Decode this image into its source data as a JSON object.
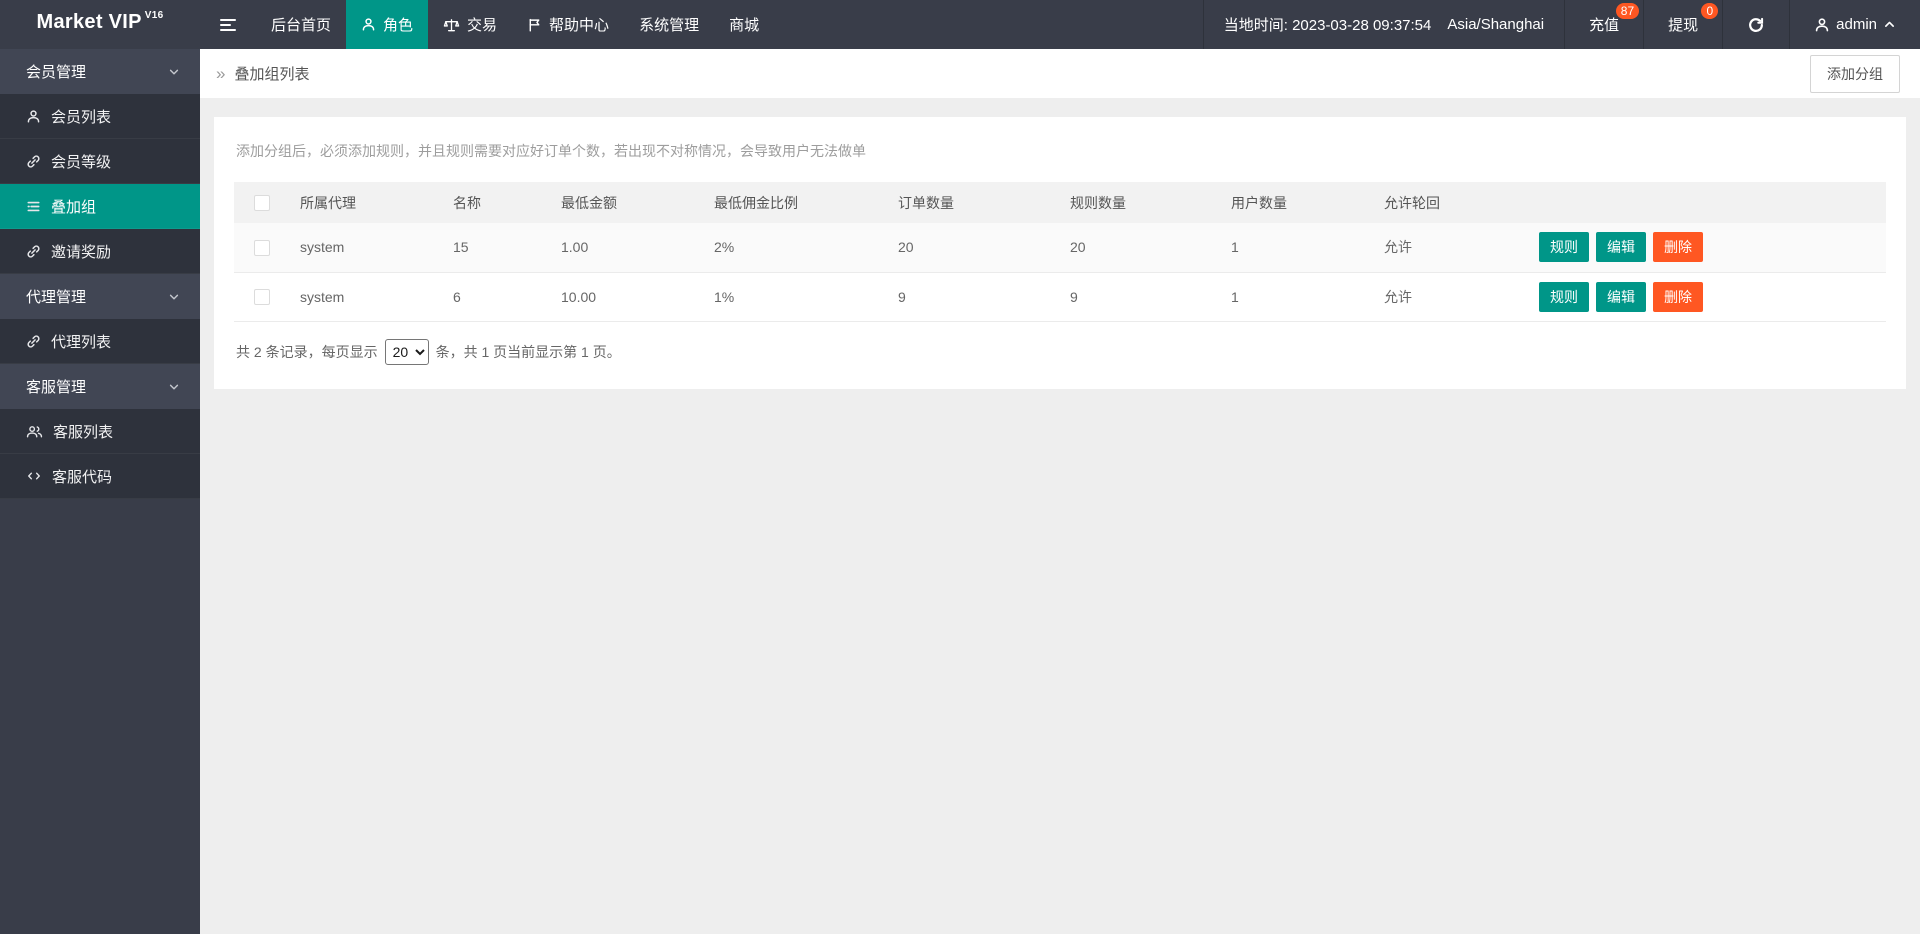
{
  "navbar": {
    "logo": "Market VIP",
    "logo_sup": "V16",
    "menu": [
      {
        "label": "后台首页",
        "icon": null,
        "active": false
      },
      {
        "label": "角色",
        "icon": "person",
        "active": true
      },
      {
        "label": "交易",
        "icon": "scales",
        "active": false
      },
      {
        "label": "帮助中心",
        "icon": "flag",
        "active": false
      },
      {
        "label": "系统管理",
        "icon": null,
        "active": false
      },
      {
        "label": "商城",
        "icon": null,
        "active": false
      }
    ],
    "time_label": "当地时间: 2023-03-28 09:37:54",
    "timezone": "Asia/Shanghai",
    "recharge": {
      "label": "充值",
      "badge": "87"
    },
    "withdraw": {
      "label": "提现",
      "badge": "0"
    },
    "user": "admin"
  },
  "sidebar": {
    "items": [
      {
        "type": "group",
        "label": "会员管理"
      },
      {
        "type": "item",
        "label": "会员列表",
        "icon": "person",
        "active": false
      },
      {
        "type": "item",
        "label": "会员等级",
        "icon": "link",
        "active": false
      },
      {
        "type": "item",
        "label": "叠加组",
        "icon": "list",
        "active": true
      },
      {
        "type": "item",
        "label": "邀请奖励",
        "icon": "link",
        "active": false
      },
      {
        "type": "group",
        "label": "代理管理"
      },
      {
        "type": "item",
        "label": "代理列表",
        "icon": "link",
        "active": false
      },
      {
        "type": "group",
        "label": "客服管理"
      },
      {
        "type": "item",
        "label": "客服列表",
        "icon": "users",
        "active": false
      },
      {
        "type": "item",
        "label": "客服代码",
        "icon": "code",
        "active": false
      }
    ]
  },
  "breadcrumb": {
    "icon": "»",
    "title": "叠加组列表"
  },
  "toolbar": {
    "add_group_label": "添加分组"
  },
  "main": {
    "hint": "添加分组后，必须添加规则，并且规则需要对应好订单个数，若出现不对称情况，会导致用户无法做单",
    "table": {
      "columns": [
        "所属代理",
        "名称",
        "最低金额",
        "最低佣金比例",
        "订单数量",
        "规则数量",
        "用户数量",
        "允许轮回"
      ],
      "rows": [
        [
          "system",
          "15",
          "1.00",
          "2%",
          "20",
          "20",
          "1",
          "允许"
        ],
        [
          "system",
          "6",
          "10.00",
          "1%",
          "9",
          "9",
          "1",
          "允许"
        ]
      ],
      "action_labels": [
        "规则",
        "编辑",
        "删除"
      ]
    },
    "pagination": {
      "prefix": "共 2 条记录，每页显示",
      "page_size": "20",
      "suffix": "条，共 1 页当前显示第 1 页。"
    }
  },
  "colors": {
    "accent": "#009688",
    "danger": "#FF5722",
    "navbar_bg": "#393D49",
    "sidebar_child_bg": "#2E323C",
    "sidebar_group_bg": "#414654",
    "page_bg": "#EEEEEE",
    "table_header_bg": "#F2F2F2"
  }
}
